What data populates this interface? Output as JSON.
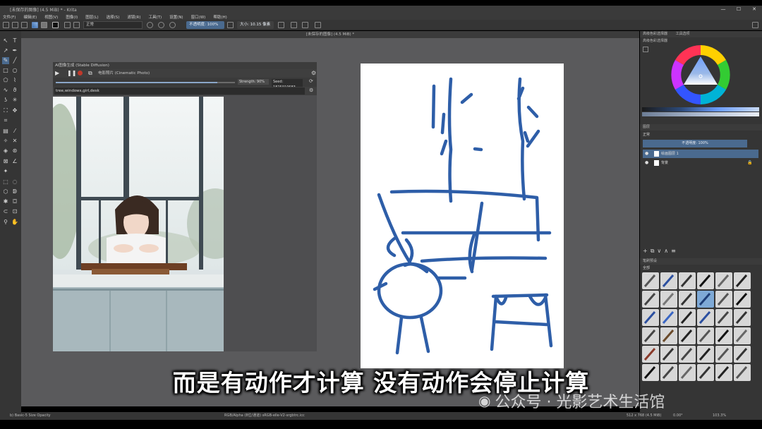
{
  "titlebar": {
    "title": "[未保存的图像] (4.5 MiB) * - Krita",
    "min": "—",
    "max": "☐",
    "close": "✕"
  },
  "menu": [
    "文件(F)",
    "编辑(E)",
    "视图(V)",
    "图像(I)",
    "图层(L)",
    "选择(S)",
    "滤镜(R)",
    "工具(T)",
    "设置(N)",
    "窗口(W)",
    "帮助(H)"
  ],
  "tool_options": {
    "blend_mode": "正常",
    "opacity_label": "不透明度:",
    "opacity_value": "100%",
    "size_label": "大小:",
    "size_value": "10.15 像素"
  },
  "document_tab": "[未保存的图像] (4.5 MiB) *",
  "ai_panel": {
    "title": "AI图像生成 (Stable Diffusion)",
    "style_label": "电影照片 (Cinematic Photo)",
    "strength_label": "Strength: 90%",
    "seed_label": "Seed: 1825910683",
    "prompt": "tree,windows,girl,desk"
  },
  "subtitle": "而是有动作才计算 没有动作会停止计算",
  "watermark": "公众号 · 光影艺术生活馆",
  "right_dock": {
    "tab_color": "高级色彩选择器",
    "tab_tool": "工具选项",
    "color_panel_title": "高级色彩选择器",
    "layers_title": "图层",
    "layers_blend": "正常",
    "layers_opacity": "不透明度:  100%",
    "layers": [
      {
        "name": "绘画图层 1",
        "selected": true
      },
      {
        "name": "背景",
        "selected": false
      }
    ],
    "brush_title": "笔刷预设",
    "brush_filter": "全部"
  },
  "status": {
    "brush": "b) Basic-5 Size Opacity",
    "color": "RGB/Alpha (8位/通道)  sRGB-elle-V2-srgbtrc.icc",
    "size": "512 x 768 (4.5 MiB)",
    "rotation": "0.00°",
    "zoom": "103.3%"
  },
  "colors": {
    "accent": "#4a6a8f",
    "stroke": "#2e5ea8"
  }
}
